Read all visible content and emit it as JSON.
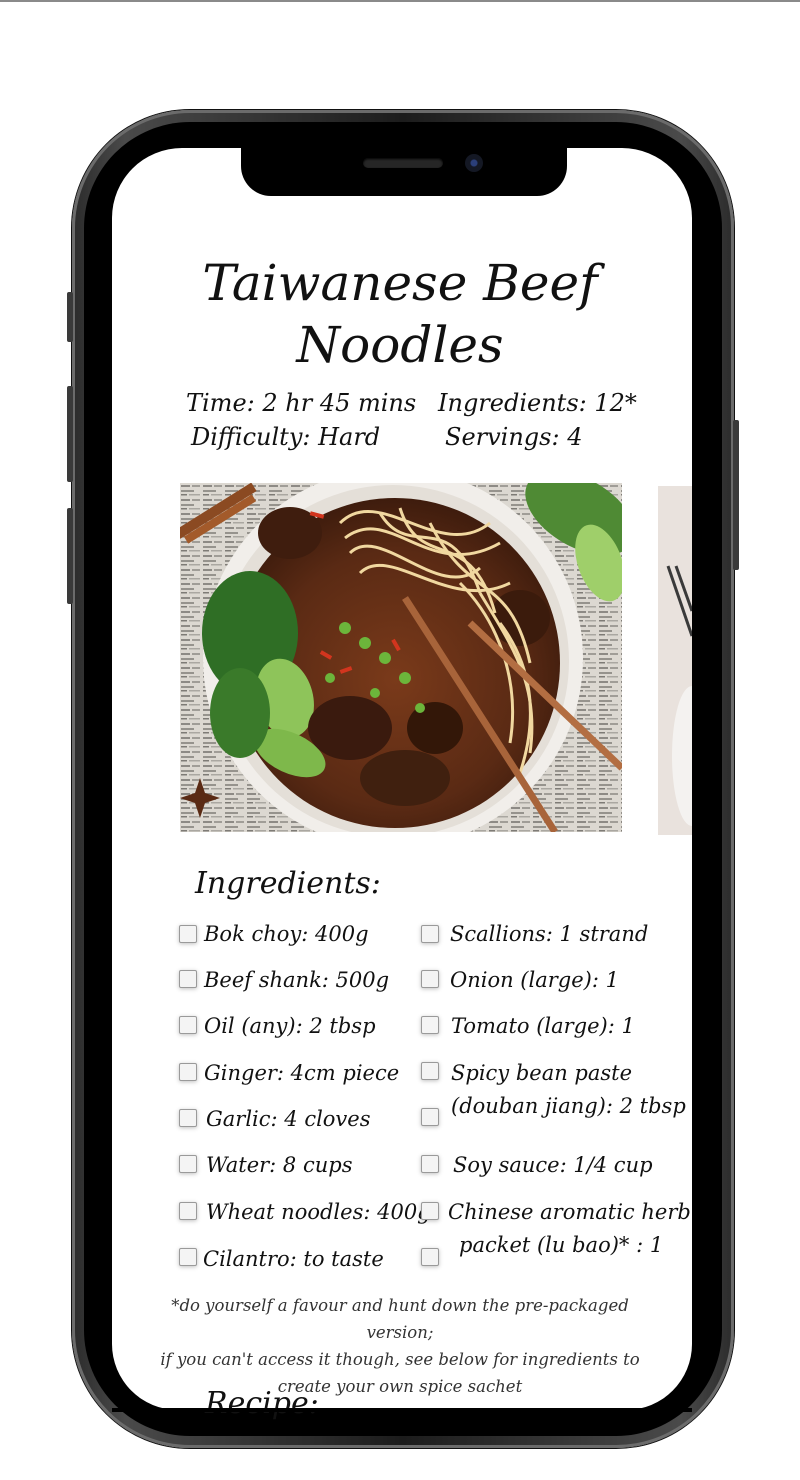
{
  "recipe": {
    "title": "Taiwanese Beef Noodles",
    "meta": {
      "time": "Time: 2 hr 45 mins",
      "ingredients": "Ingredients: 12*",
      "difficulty": "Difficulty: Hard",
      "servings": "Servings: 4"
    },
    "ingredients_heading": "Ingredients:",
    "ingredients_left": [
      "Bok choy: 400g",
      "Beef shank: 500g",
      "Oil (any): 2 tbsp",
      "Ginger: 4cm piece",
      "Garlic: 4 cloves",
      "Water: 8 cups",
      "Wheat noodles: 400g",
      "Cilantro: to taste"
    ],
    "ingredients_right": [
      "Scallions: 1 strand",
      "Onion (large): 1",
      "Tomato (large): 1",
      "Spicy bean paste",
      "(douban jiang): 2 tbsp",
      "Soy sauce: 1/4 cup",
      "Chinese aromatic herb",
      "packet (lu bao)* : 1"
    ],
    "note_lines": [
      "*do yourself a favour and hunt down the pre-packaged version;",
      "if you can't access it though, see below for ingredients to",
      "create your own spice sachet"
    ],
    "recipe_heading": "Recipe:"
  },
  "colors": {
    "text": "#111111",
    "broth": "#5a2a14",
    "bowl": "#f1eeea",
    "bok_choy": "#5f9a3c",
    "phone_frame": "#1c1c1c"
  }
}
